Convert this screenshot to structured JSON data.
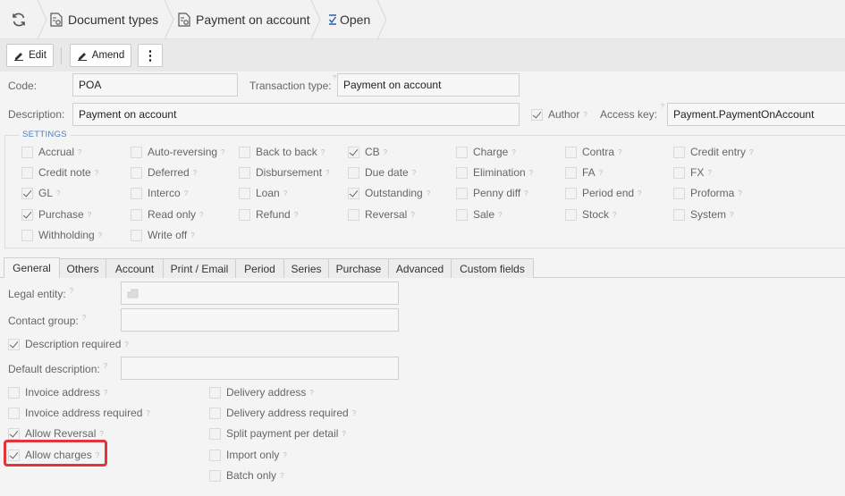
{
  "breadcrumb": {
    "items": [
      {
        "label": "Document types"
      },
      {
        "label": "Payment on account"
      },
      {
        "label": "Open"
      }
    ]
  },
  "toolbar": {
    "edit_label": "Edit",
    "amend_label": "Amend",
    "more_label": "⋮"
  },
  "form": {
    "code_label": "Code:",
    "code_value": "POA",
    "transaction_type_label": "Transaction type:",
    "transaction_type_value": "Payment on account",
    "description_label": "Description:",
    "description_value": "Payment on account",
    "author_label": "Author",
    "author_checked": true,
    "access_key_label": "Access key:",
    "access_key_value": "Payment.PaymentOnAccount"
  },
  "settings": {
    "legend": "SETTINGS",
    "items": [
      {
        "label": "Accrual",
        "checked": false
      },
      {
        "label": "Auto-reversing",
        "checked": false
      },
      {
        "label": "Back to back",
        "checked": false
      },
      {
        "label": "CB",
        "checked": true
      },
      {
        "label": "Charge",
        "checked": false
      },
      {
        "label": "Contra",
        "checked": false
      },
      {
        "label": "Credit entry",
        "checked": false
      },
      {
        "label": "Credit note",
        "checked": false
      },
      {
        "label": "Deferred",
        "checked": false
      },
      {
        "label": "Disbursement",
        "checked": false
      },
      {
        "label": "Due date",
        "checked": false
      },
      {
        "label": "Elimination",
        "checked": false
      },
      {
        "label": "FA",
        "checked": false
      },
      {
        "label": "FX",
        "checked": false
      },
      {
        "label": "GL",
        "checked": true
      },
      {
        "label": "Interco",
        "checked": false
      },
      {
        "label": "Loan",
        "checked": false
      },
      {
        "label": "Outstanding",
        "checked": true
      },
      {
        "label": "Penny diff",
        "checked": false
      },
      {
        "label": "Period end",
        "checked": false
      },
      {
        "label": "Proforma",
        "checked": false
      },
      {
        "label": "Purchase",
        "checked": true
      },
      {
        "label": "Read only",
        "checked": false
      },
      {
        "label": "Refund",
        "checked": false
      },
      {
        "label": "Reversal",
        "checked": false
      },
      {
        "label": "Sale",
        "checked": false
      },
      {
        "label": "Stock",
        "checked": false
      },
      {
        "label": "System",
        "checked": false
      },
      {
        "label": "Withholding",
        "checked": false
      },
      {
        "label": "Write off",
        "checked": false
      }
    ]
  },
  "tabs": [
    {
      "label": "General",
      "active": true
    },
    {
      "label": "Others"
    },
    {
      "label": "Account"
    },
    {
      "label": "Print / Email"
    },
    {
      "label": "Period"
    },
    {
      "label": "Series"
    },
    {
      "label": "Purchase"
    },
    {
      "label": "Advanced"
    },
    {
      "label": "Custom fields"
    }
  ],
  "general": {
    "legal_entity_label": "Legal entity:",
    "legal_entity_value": "",
    "contact_group_label": "Contact group:",
    "contact_group_value": "",
    "description_required_label": "Description required",
    "description_required_checked": true,
    "default_description_label": "Default description:",
    "default_description_value": "",
    "left_checks": [
      {
        "label": "Invoice address",
        "checked": false
      },
      {
        "label": "Invoice address required",
        "checked": false
      },
      {
        "label": "Allow Reversal",
        "checked": true
      },
      {
        "label": "Allow charges",
        "checked": true
      }
    ],
    "right_checks": [
      {
        "label": "Delivery address",
        "checked": false
      },
      {
        "label": "Delivery address required",
        "checked": false
      },
      {
        "label": "Split payment per detail",
        "checked": false
      },
      {
        "label": "Import only",
        "checked": false
      },
      {
        "label": "Batch only",
        "checked": false
      }
    ]
  },
  "help_mark": "?",
  "colors": {
    "accent": "#4a7fbf",
    "highlight": "#e0353b"
  }
}
